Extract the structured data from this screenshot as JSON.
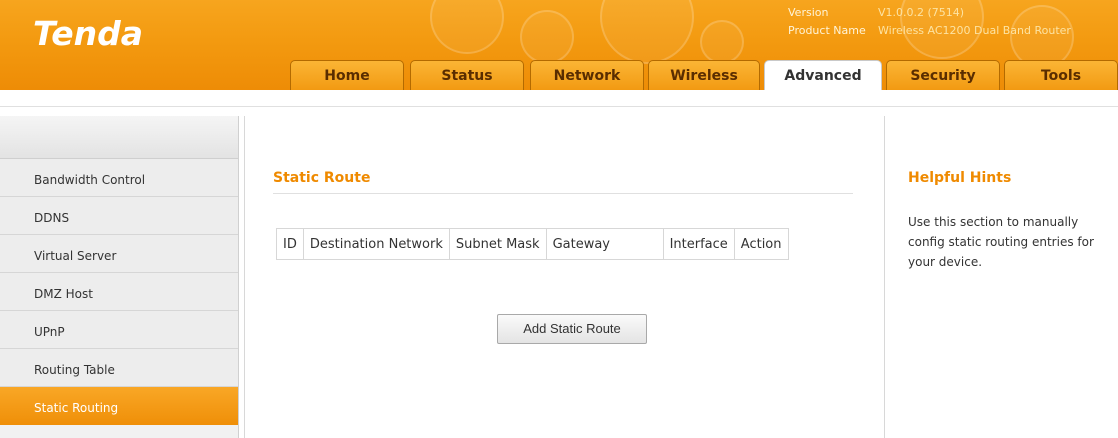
{
  "header": {
    "logo": "Tenda",
    "version_label": "Version",
    "version_value": "V1.0.0.2 (7514)",
    "product_label": "Product Name",
    "product_value": "Wireless AC1200 Dual Band Router"
  },
  "tabs": [
    {
      "label": "Home"
    },
    {
      "label": "Status"
    },
    {
      "label": "Network"
    },
    {
      "label": "Wireless"
    },
    {
      "label": "Advanced",
      "active": true
    },
    {
      "label": "Security"
    },
    {
      "label": "Tools"
    }
  ],
  "sidebar": {
    "items": [
      {
        "label": "Bandwidth Control"
      },
      {
        "label": "DDNS"
      },
      {
        "label": "Virtual Server"
      },
      {
        "label": "DMZ Host"
      },
      {
        "label": "UPnP"
      },
      {
        "label": "Routing Table"
      },
      {
        "label": "Static Routing",
        "active": true
      }
    ]
  },
  "main": {
    "title": "Static Route",
    "table_headers": [
      "ID",
      "Destination Network",
      "Subnet Mask",
      "Gateway",
      "Interface",
      "Action"
    ],
    "add_button": "Add Static Route"
  },
  "hints": {
    "title": "Helpful Hints",
    "text": "Use this section to manually config static routing entries for your device."
  },
  "colors": {
    "accent": "#ef8a00",
    "header_orange": "#f39a10"
  }
}
